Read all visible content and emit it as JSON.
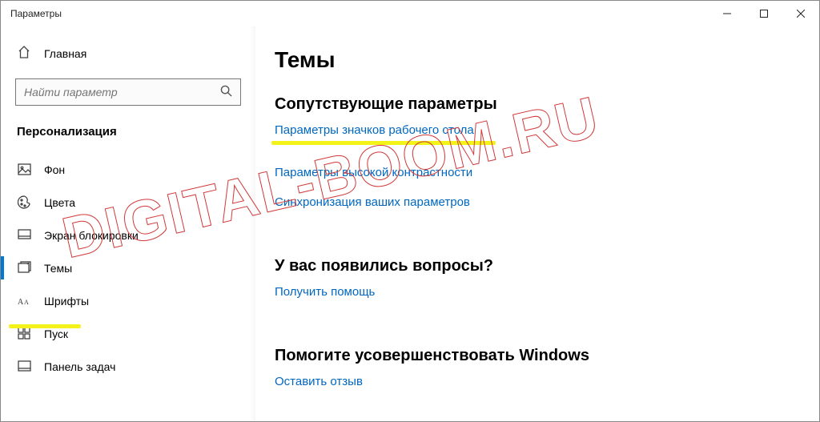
{
  "titlebar": {
    "title": "Параметры"
  },
  "sidebar": {
    "home": "Главная",
    "search_placeholder": "Найти параметр",
    "section": "Персонализация",
    "items": [
      {
        "id": "background",
        "label": "Фон"
      },
      {
        "id": "colors",
        "label": "Цвета"
      },
      {
        "id": "lockscreen",
        "label": "Экран блокировки"
      },
      {
        "id": "themes",
        "label": "Темы",
        "active": true
      },
      {
        "id": "fonts",
        "label": "Шрифты"
      },
      {
        "id": "start",
        "label": "Пуск"
      },
      {
        "id": "taskbar",
        "label": "Панель задач"
      }
    ]
  },
  "content": {
    "heading": "Темы",
    "related_heading": "Сопутствующие параметры",
    "links": {
      "desktop_icons": "Параметры значков рабочего стола",
      "high_contrast": "Параметры высокой контрастности",
      "sync": "Синхронизация ваших параметров"
    },
    "questions_heading": "У вас появились вопросы?",
    "get_help": "Получить помощь",
    "improve_heading": "Помогите усовершенствовать Windows",
    "feedback": "Оставить отзыв"
  },
  "watermark": "DIGITAL-BOOM.RU"
}
